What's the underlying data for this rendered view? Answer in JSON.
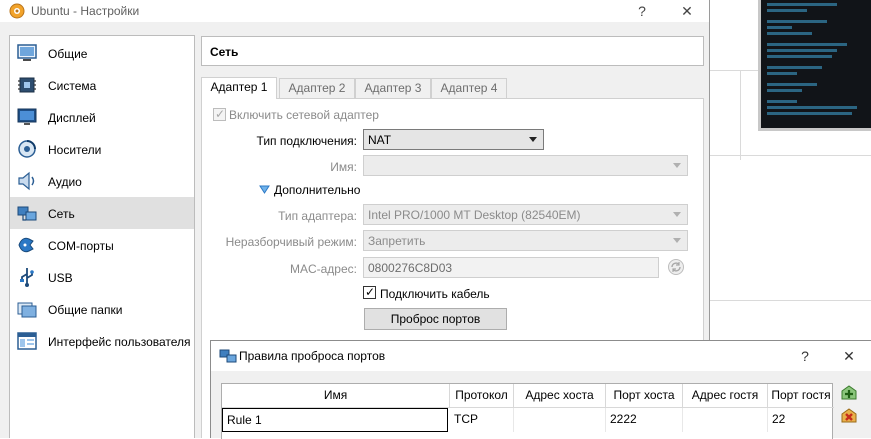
{
  "window": {
    "title": "Ubuntu - Настройки",
    "help_glyph": "?",
    "close_glyph": "✕"
  },
  "sidebar": {
    "items": [
      {
        "label": "Общие",
        "icon": "general-icon"
      },
      {
        "label": "Система",
        "icon": "system-chip-icon"
      },
      {
        "label": "Дисплей",
        "icon": "display-monitor-icon"
      },
      {
        "label": "Носители",
        "icon": "storage-disk-icon"
      },
      {
        "label": "Аудио",
        "icon": "audio-speaker-icon"
      },
      {
        "label": "Сеть",
        "icon": "network-icon",
        "selected": true
      },
      {
        "label": "COM-порты",
        "icon": "serial-port-icon"
      },
      {
        "label": "USB",
        "icon": "usb-icon"
      },
      {
        "label": "Общие папки",
        "icon": "shared-folder-icon"
      },
      {
        "label": "Интерфейс пользователя",
        "icon": "user-interface-icon"
      }
    ]
  },
  "section": {
    "title": "Сеть"
  },
  "tabs": [
    "Адаптер 1",
    "Адаптер 2",
    "Адаптер 3",
    "Адаптер 4"
  ],
  "adapter": {
    "enable_label": "Включить сетевой адаптер",
    "enable_checked": true,
    "attach_label": "Тип подключения:",
    "attach_value": "NAT",
    "name_label": "Имя:",
    "name_value": "",
    "advanced_label": "Дополнительно",
    "adapter_type_label": "Тип адаптера:",
    "adapter_type_value": "Intel PRO/1000 MT Desktop (82540EM)",
    "promisc_label": "Неразборчивый режим:",
    "promisc_value": "Запретить",
    "mac_label": "MAC-адрес:",
    "mac_value": "0800276C8D03",
    "cable_label": "Подключить кабель",
    "cable_checked": true,
    "port_forward_label": "Проброс портов"
  },
  "port_forwarding": {
    "title": "Правила проброса портов",
    "help_glyph": "?",
    "close_glyph": "✕",
    "columns": [
      "Имя",
      "Протокол",
      "Адрес хоста",
      "Порт хоста",
      "Адрес гостя",
      "Порт гостя"
    ],
    "rows": [
      [
        "Rule 1",
        "TCP",
        "",
        "2222",
        "",
        "22"
      ]
    ]
  },
  "colors": {
    "accent": "#2b78c5",
    "add_icon": "#3ea23a",
    "remove_icon": "#d9452b"
  }
}
